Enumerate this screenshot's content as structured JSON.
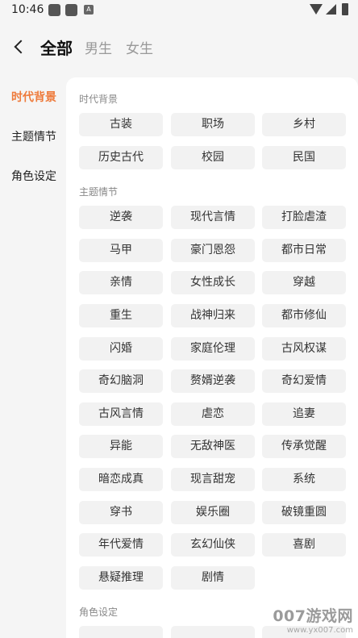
{
  "status_bar": {
    "time": "10:46",
    "a_icon_letter": "A"
  },
  "header": {
    "back_icon": "chevron-left-icon",
    "tabs": [
      {
        "label": "全部",
        "active": true
      },
      {
        "label": "男生",
        "active": false
      },
      {
        "label": "女生",
        "active": false
      }
    ]
  },
  "sidebar": {
    "accent_color": "#ee7b3c",
    "items": [
      {
        "label": "时代背景",
        "active": true
      },
      {
        "label": "主题情节",
        "active": false
      },
      {
        "label": "角色设定",
        "active": false
      }
    ]
  },
  "sections": [
    {
      "title": "时代背景",
      "chips": [
        "古装",
        "职场",
        "乡村",
        "历史古代",
        "校园",
        "民国"
      ]
    },
    {
      "title": "主题情节",
      "chips": [
        "逆袭",
        "现代言情",
        "打脸虐渣",
        "马甲",
        "豪门恩怨",
        "都市日常",
        "亲情",
        "女性成长",
        "穿越",
        "重生",
        "战神归来",
        "都市修仙",
        "闪婚",
        "家庭伦理",
        "古风权谋",
        "奇幻脑洞",
        "赘婿逆袭",
        "奇幻爱情",
        "古风言情",
        "虐恋",
        "追妻",
        "异能",
        "无敌神医",
        "传承觉醒",
        "暗恋成真",
        "现言甜宠",
        "系统",
        "穿书",
        "娱乐圈",
        "破镜重圆",
        "年代爱情",
        "玄幻仙侠",
        "喜剧",
        "悬疑推理",
        "剧情"
      ]
    },
    {
      "title": "角色设定",
      "chips": [
        "",
        "",
        ""
      ]
    }
  ],
  "watermark": {
    "main": "007游戏网",
    "sub": "www.yx007.com"
  }
}
